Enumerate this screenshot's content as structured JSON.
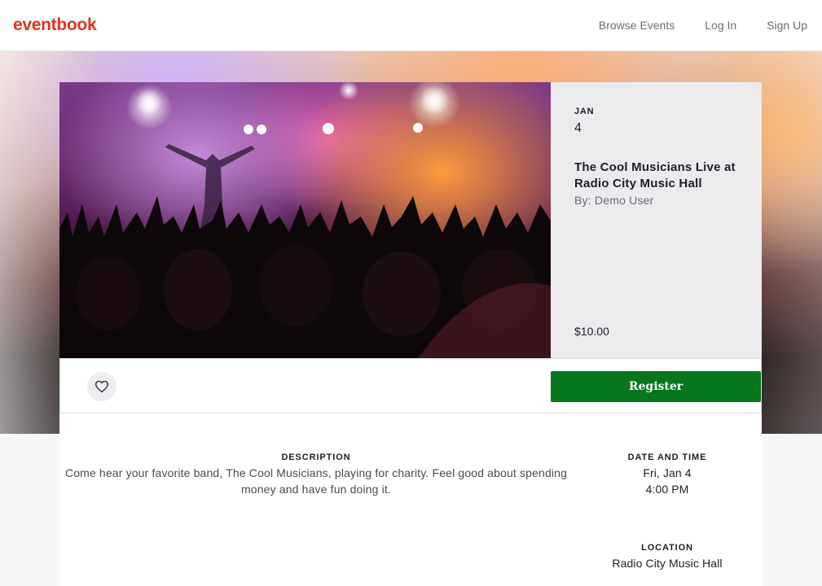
{
  "header": {
    "logo": "eventbook",
    "nav": [
      "Browse Events",
      "Log In",
      "Sign Up"
    ]
  },
  "event": {
    "month": "JAN",
    "day": "4",
    "title": "The Cool Musicians Live at Radio City Music Hall",
    "organizer": "By: Demo User",
    "price": "$10.00",
    "register_label": "Register",
    "like_icon": "heart-icon"
  },
  "details": {
    "description_label": "DESCRIPTION",
    "description": "Come hear your favorite band, The Cool Musicians, playing for charity. Feel good about spending money and have fun doing it.",
    "datetime_label": "DATE AND TIME",
    "date": "Fri, Jan 4",
    "time": "4:00 PM",
    "location_label": "LOCATION",
    "location": "Radio City Music Hall"
  },
  "colors": {
    "brand": "#e0341f",
    "register": "#07771f"
  }
}
